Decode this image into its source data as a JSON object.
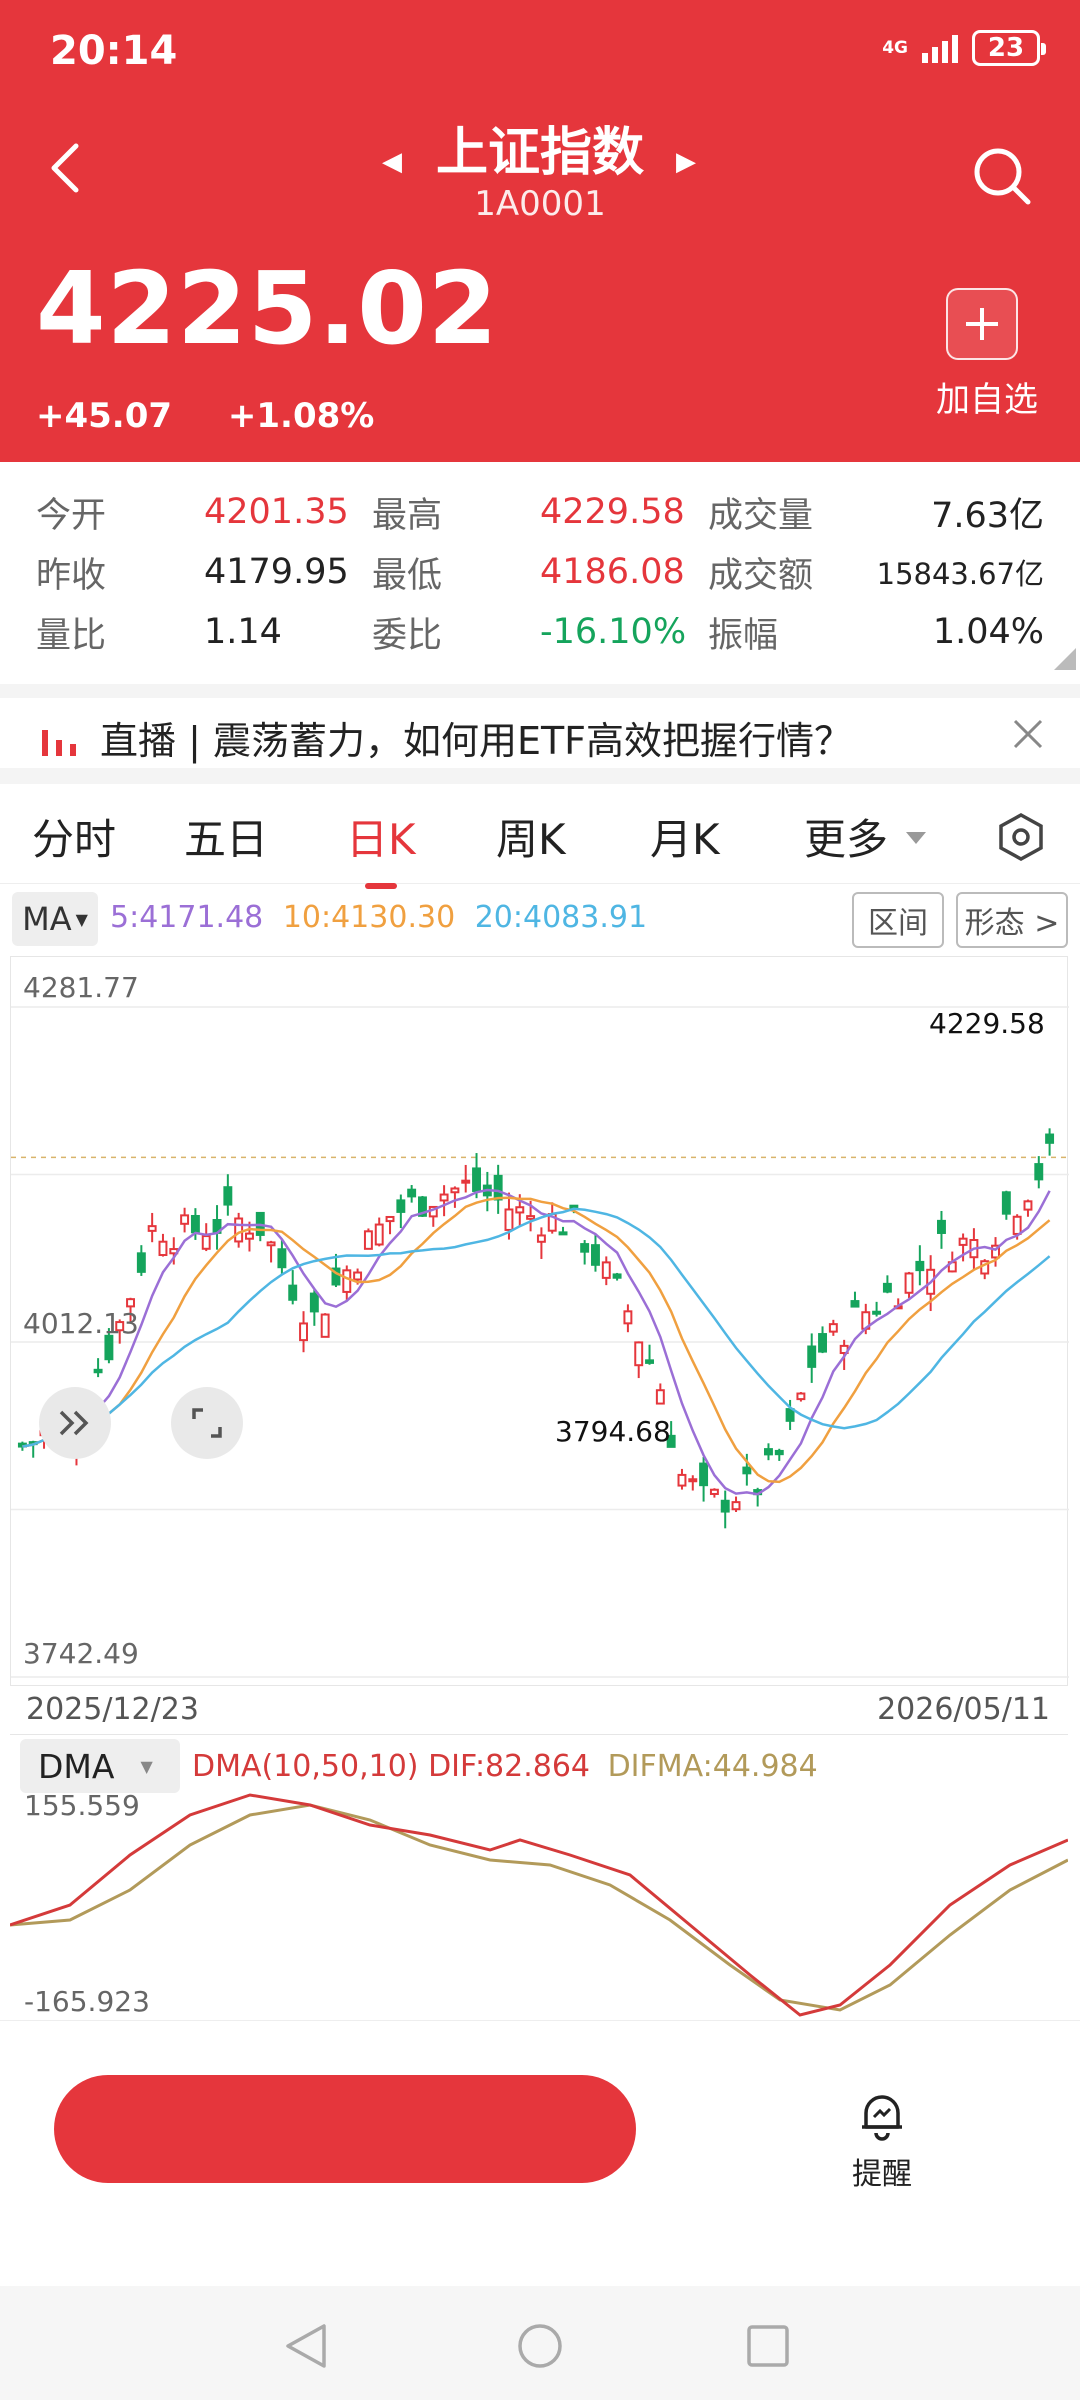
{
  "status": {
    "time": "20:14",
    "network": "4G",
    "battery": "23"
  },
  "header": {
    "title": "上证指数",
    "code": "1A0001",
    "price": "4225.02",
    "change": "+45.07",
    "change_pct": "+1.08%",
    "add_label": "加自选"
  },
  "stats": {
    "rows": [
      [
        {
          "k": "今开",
          "v": "4201.35"
        },
        {
          "k": "最高",
          "v": "4229.58"
        },
        {
          "k": "成交量",
          "v": "7.63亿"
        }
      ],
      [
        {
          "k": "昨收",
          "v": "4179.95"
        },
        {
          "k": "最低",
          "v": "4186.08"
        },
        {
          "k": "成交额",
          "v": "15843.67亿"
        }
      ],
      [
        {
          "k": "量比",
          "v": "1.14"
        },
        {
          "k": "委比",
          "v": "-16.10%"
        },
        {
          "k": "振幅",
          "v": "1.04%"
        }
      ]
    ]
  },
  "live": {
    "text": "直播 | 震荡蓄力，如何用ETF高效把握行情？"
  },
  "tabs": [
    "分时",
    "五日",
    "日K",
    "周K",
    "月K",
    "更多"
  ],
  "ma": {
    "button": "MA",
    "ma5": "5:4171.48",
    "ma10": "10:4130.30",
    "ma20": "20:4083.91",
    "range_btn": "区间",
    "pattern_btn": "形态 >"
  },
  "chart_data": {
    "type": "candlestick",
    "y_top_label": "4281.77",
    "y_mid_label": "4012.13",
    "y_bottom_label": "3742.49",
    "ylim": [
      3742.49,
      4281.77
    ],
    "high_marker": "4229.58",
    "low_marker": "3794.68",
    "x_start": "2025/12/23",
    "x_end": "2026/05/11",
    "series_colors": {
      "ma5": "#9b6fd6",
      "ma10": "#f0a040",
      "ma20": "#4fb6e3",
      "up": "#e5363c",
      "down": "#15a45c"
    }
  },
  "dma": {
    "button": "DMA",
    "params": "DMA(10,50,10)",
    "dif": "DIF:82.864",
    "difma": "DIFMA:44.984",
    "top_label": "155.559",
    "bottom_label": "-165.923",
    "colors": {
      "dif": "#d43a3a",
      "difma": "#b29a5a"
    }
  },
  "bottom": {
    "alert_label": "提醒"
  }
}
